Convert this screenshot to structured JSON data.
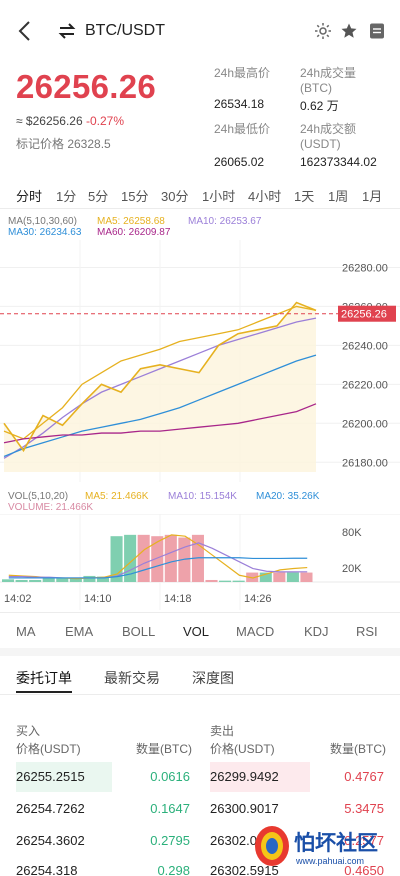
{
  "header": {
    "pair": "BTC/USDT",
    "icons": [
      "back-arrow-icon",
      "swap-icon",
      "sun-icon",
      "star-icon",
      "document-icon"
    ]
  },
  "ticker": {
    "last_price": "26256.26",
    "usd_equiv": "≈ $26256.26",
    "change_pct": "-0.27%",
    "mark_price": "标记价格 26328.5",
    "high_label": "24h最高价",
    "high_value": "26534.18",
    "low_label": "24h最低价",
    "low_value": "26065.02",
    "vol_label": "24h成交量\n(BTC)",
    "vol_value": "0.62 万",
    "amt_label": "24h成交额\n(USDT)",
    "amt_value": "162373344.02"
  },
  "intervals": [
    "分时",
    "1分",
    "5分",
    "15分",
    "30分",
    "1小时",
    "4小时",
    "1天",
    "1周",
    "1月"
  ],
  "intervals_active": 0,
  "main_legend": {
    "title": "MA(5,10,30,60)",
    "ma5": "MA5: 26258.68",
    "ma10": "MA10: 26253.67",
    "ma30": "MA30: 26234.63",
    "ma60": "MA60: 26209.87"
  },
  "price_axis": [
    "26280.00",
    "26260.00",
    "26240.00",
    "26220.00",
    "26200.00",
    "26180.00"
  ],
  "current_price_tag": "26256.26",
  "vol_legend": {
    "title": "VOL(5,10,20)",
    "ma5": "MA5: 21.466K",
    "ma10": "MA10: 15.154K",
    "ma20": "MA20: 35.26K",
    "volume": "VOLUME: 21.466K"
  },
  "vol_axis": [
    "80K",
    "20K"
  ],
  "time_axis": [
    "14:02",
    "14:10",
    "14:18",
    "14:26"
  ],
  "indicator_tabs": [
    "MA",
    "EMA",
    "BOLL",
    "VOL",
    "MACD",
    "KDJ",
    "RSI"
  ],
  "indicator_active": 3,
  "orderbook_tabs": [
    "委托订单",
    "最新交易",
    "深度图"
  ],
  "orderbook_active": 0,
  "orderbook": {
    "bid_title": "买入",
    "ask_title": "卖出",
    "bid_price_hdr": "价格(USDT)",
    "bid_qty_hdr": "数量(BTC)",
    "ask_price_hdr": "价格(USDT)",
    "ask_qty_hdr": "数量(BTC)",
    "rows": [
      {
        "bid_price": "26255.2515",
        "bid_qty": "0.0616",
        "ask_price": "26299.9492",
        "ask_qty": "0.4767"
      },
      {
        "bid_price": "26254.7262",
        "bid_qty": "0.1647",
        "ask_price": "26300.9017",
        "ask_qty": "5.3475"
      },
      {
        "bid_price": "26254.3602",
        "bid_qty": "0.2795",
        "ask_price": "26302.0",
        "ask_qty": "0.2577"
      },
      {
        "bid_price": "26254.318",
        "bid_qty": "0.298",
        "ask_price": "26302.5915",
        "ask_qty": "0.4650"
      }
    ]
  },
  "watermark": {
    "text": "怕坏社区",
    "url": "www.pahuai.com"
  },
  "colors": {
    "up_green": "#2bb07b",
    "down_red": "#e0424f",
    "ma5": "#e6b120",
    "ma10": "#9b7fd8",
    "ma30": "#2f8fd8",
    "ma60": "#a8268a"
  },
  "chart_data": [
    {
      "type": "line",
      "title": "",
      "ylabel": "",
      "ylim": [
        26175,
        26290
      ],
      "x": [
        "14:02",
        "14:10",
        "14:18",
        "14:26"
      ],
      "series": [
        {
          "name": "MA5",
          "values": [
            26196,
            26192,
            26200,
            26208,
            26220,
            26226,
            26232,
            26235,
            26238,
            26242,
            26244,
            26246,
            26248,
            26252,
            26256,
            26260,
            26258
          ]
        },
        {
          "name": "MA10",
          "values": [
            26182,
            26188,
            26195,
            26203,
            26210,
            26216,
            26220,
            26224,
            26228,
            26232,
            26236,
            26240,
            26243,
            26246,
            26249,
            26252,
            26254
          ]
        },
        {
          "name": "MA30",
          "values": [
            26183,
            26187,
            26190,
            26193,
            26196,
            26198,
            26200,
            26202,
            26205,
            26208,
            26212,
            26216,
            26220,
            26224,
            26228,
            26232,
            26235
          ]
        },
        {
          "name": "MA60",
          "values": [
            26190,
            26192,
            26193,
            26194,
            26194,
            26195,
            26195,
            26196,
            26196,
            26197,
            26198,
            26199,
            26200,
            26202,
            26204,
            26206,
            26210
          ]
        }
      ],
      "price_line": [
        26200,
        26186,
        26204,
        26199,
        26210,
        26220,
        26216,
        26228,
        26230,
        26228,
        26226,
        26240,
        26246,
        26248,
        26250,
        26262,
        26258
      ],
      "current_price": 26256.26
    },
    {
      "type": "bar",
      "title": "",
      "ylim": [
        0,
        95000
      ],
      "values": [
        4000,
        3000,
        3000,
        7000,
        6000,
        6000,
        9000,
        8000,
        68000,
        70000,
        70000,
        68000,
        70000,
        66000,
        70000,
        3000,
        2000,
        2000,
        14000,
        14000,
        14000,
        14000,
        14000
      ],
      "up": [
        true,
        true,
        true,
        true,
        true,
        true,
        true,
        true,
        true,
        true,
        false,
        false,
        false,
        false,
        false,
        false,
        true,
        true,
        false,
        true,
        false,
        true,
        false
      ],
      "lines": [
        {
          "name": "MA5",
          "values": [
            10000,
            9000,
            8000,
            6000,
            6000,
            5000,
            6000,
            7000,
            12000,
            30000,
            48000,
            60000,
            70000,
            68000,
            55000,
            40000,
            25000,
            10000,
            6000,
            12000,
            18000,
            20000,
            21466
          ]
        },
        {
          "name": "MA10",
          "values": [
            8000,
            8000,
            7000,
            7000,
            6000,
            6000,
            6000,
            6000,
            9000,
            18000,
            28000,
            36000,
            44000,
            52000,
            58000,
            50000,
            40000,
            30000,
            20000,
            16000,
            15000,
            15000,
            15154
          ]
        },
        {
          "name": "MA20",
          "values": [
            6000,
            6000,
            6000,
            6000,
            6000,
            6000,
            6000,
            6000,
            8000,
            12000,
            18000,
            24000,
            30000,
            34000,
            36000,
            36000,
            36000,
            36000,
            35000,
            35000,
            35000,
            35260,
            35260
          ]
        }
      ]
    }
  ]
}
